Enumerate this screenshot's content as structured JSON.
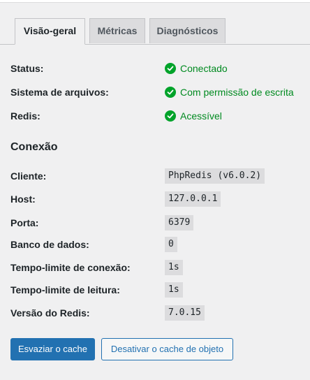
{
  "tabs": [
    {
      "label": "Visão-geral",
      "active": true
    },
    {
      "label": "Métricas",
      "active": false
    },
    {
      "label": "Diagnósticos",
      "active": false
    }
  ],
  "status_rows": [
    {
      "label": "Status:",
      "value": "Conectado",
      "icon": "check-circle-icon"
    },
    {
      "label": "Sistema de arquivos:",
      "value": "Com permissão de escrita",
      "icon": "check-circle-icon"
    },
    {
      "label": "Redis:",
      "value": "Acessível",
      "icon": "check-circle-icon"
    }
  ],
  "connection": {
    "title": "Conexão",
    "rows": [
      {
        "label": "Cliente:",
        "value": "PhpRedis (v6.0.2)"
      },
      {
        "label": "Host:",
        "value": "127.0.0.1"
      },
      {
        "label": "Porta:",
        "value": "6379"
      },
      {
        "label": "Banco de dados:",
        "value": "0"
      },
      {
        "label": "Tempo-limite de conexão:",
        "value": "1s"
      },
      {
        "label": "Tempo-limite de leitura:",
        "value": "1s"
      },
      {
        "label": "Versão do Redis:",
        "value": "7.0.15"
      }
    ]
  },
  "buttons": {
    "flush_label": "Esvaziar o cache",
    "disable_label": "Desativar o cache de objeto"
  },
  "colors": {
    "success": "#00a32a",
    "primary": "#2271b1",
    "code_bg": "#dcdcde"
  }
}
